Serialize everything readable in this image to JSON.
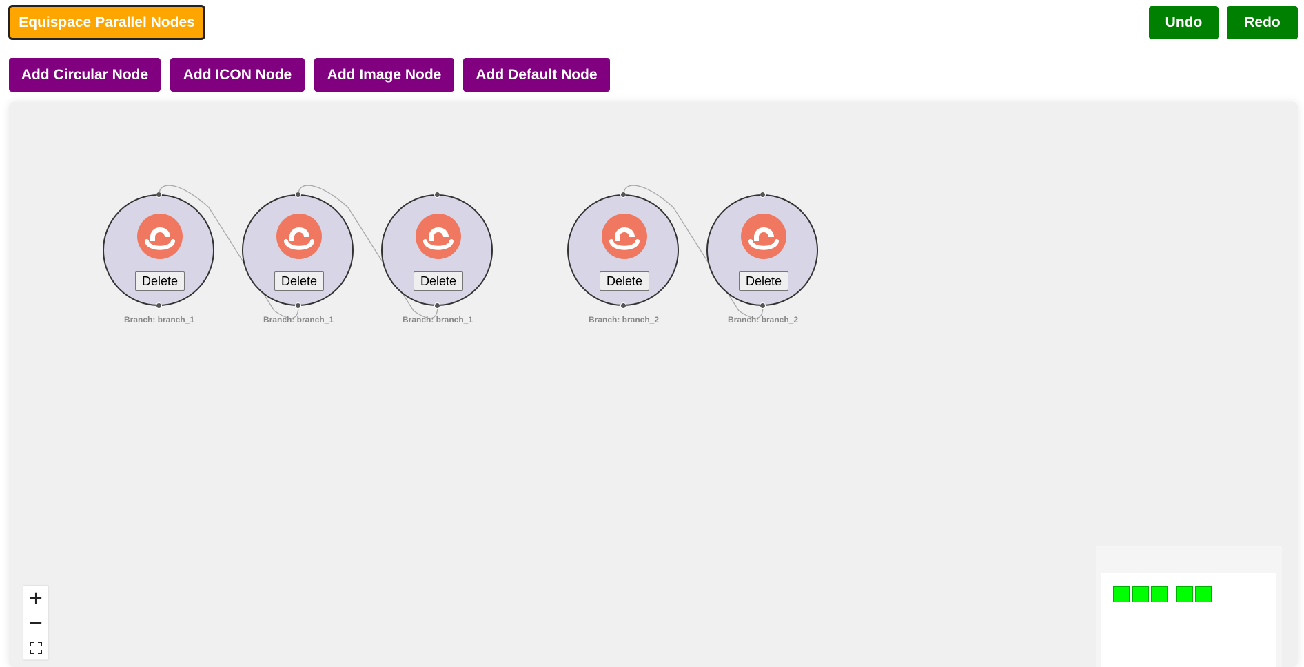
{
  "toolbar": {
    "equispace_label": "Equispace Parallel Nodes",
    "undo_label": "Undo",
    "redo_label": "Redo",
    "add_circular_label": "Add Circular Node",
    "add_icon_label": "Add ICON Node",
    "add_image_label": "Add Image Node",
    "add_default_label": "Add Default Node"
  },
  "colors": {
    "equispace": "#ffa500",
    "undo_redo": "#008000",
    "add_buttons": "#800080",
    "node_fill": "#d8d6e6",
    "logo": "#f07860",
    "minimap_node": "#00ff00"
  },
  "nodes": [
    {
      "delete_label": "Delete",
      "branch_label": "Branch: branch_1",
      "icon": "logo-icon"
    },
    {
      "delete_label": "Delete",
      "branch_label": "Branch: branch_1",
      "icon": "logo-icon"
    },
    {
      "delete_label": "Delete",
      "branch_label": "Branch: branch_1",
      "icon": "logo-icon"
    },
    {
      "delete_label": "Delete",
      "branch_label": "Branch: branch_2",
      "icon": "logo-icon"
    },
    {
      "delete_label": "Delete",
      "branch_label": "Branch: branch_2",
      "icon": "logo-icon"
    }
  ],
  "controls": {
    "zoom_in": "+",
    "zoom_out": "−",
    "fit_view": "fit-view-icon"
  }
}
